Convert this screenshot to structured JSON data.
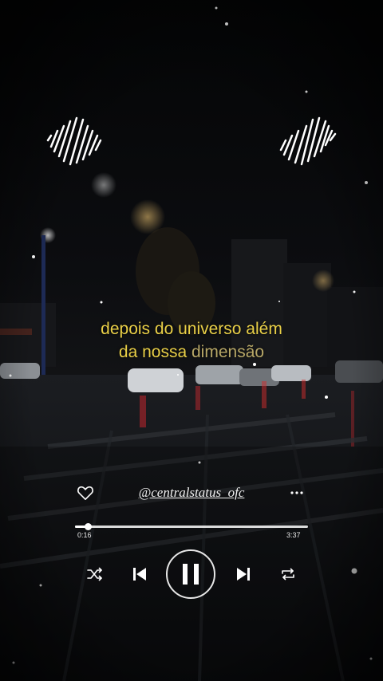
{
  "lyrics": {
    "line1": "depois do universo além",
    "line2_a": "da nossa ",
    "line2_b": "dimensão"
  },
  "player": {
    "handle": "@centralstatus_ofc",
    "current_time": "0:16",
    "total_time": "3:37",
    "progress": 0.055
  },
  "icons": {
    "like": "heart-icon",
    "more": "more-dots-icon",
    "shuffle": "shuffle-icon",
    "previous": "skip-previous-icon",
    "pause": "pause-icon",
    "next": "skip-next-icon",
    "repeat": "repeat-icon",
    "decor": "sound-wave-icon"
  },
  "colors": {
    "lyrics": "#e9cf47",
    "lyrics_dim": "#b7a767",
    "controls": "#ffffff"
  }
}
